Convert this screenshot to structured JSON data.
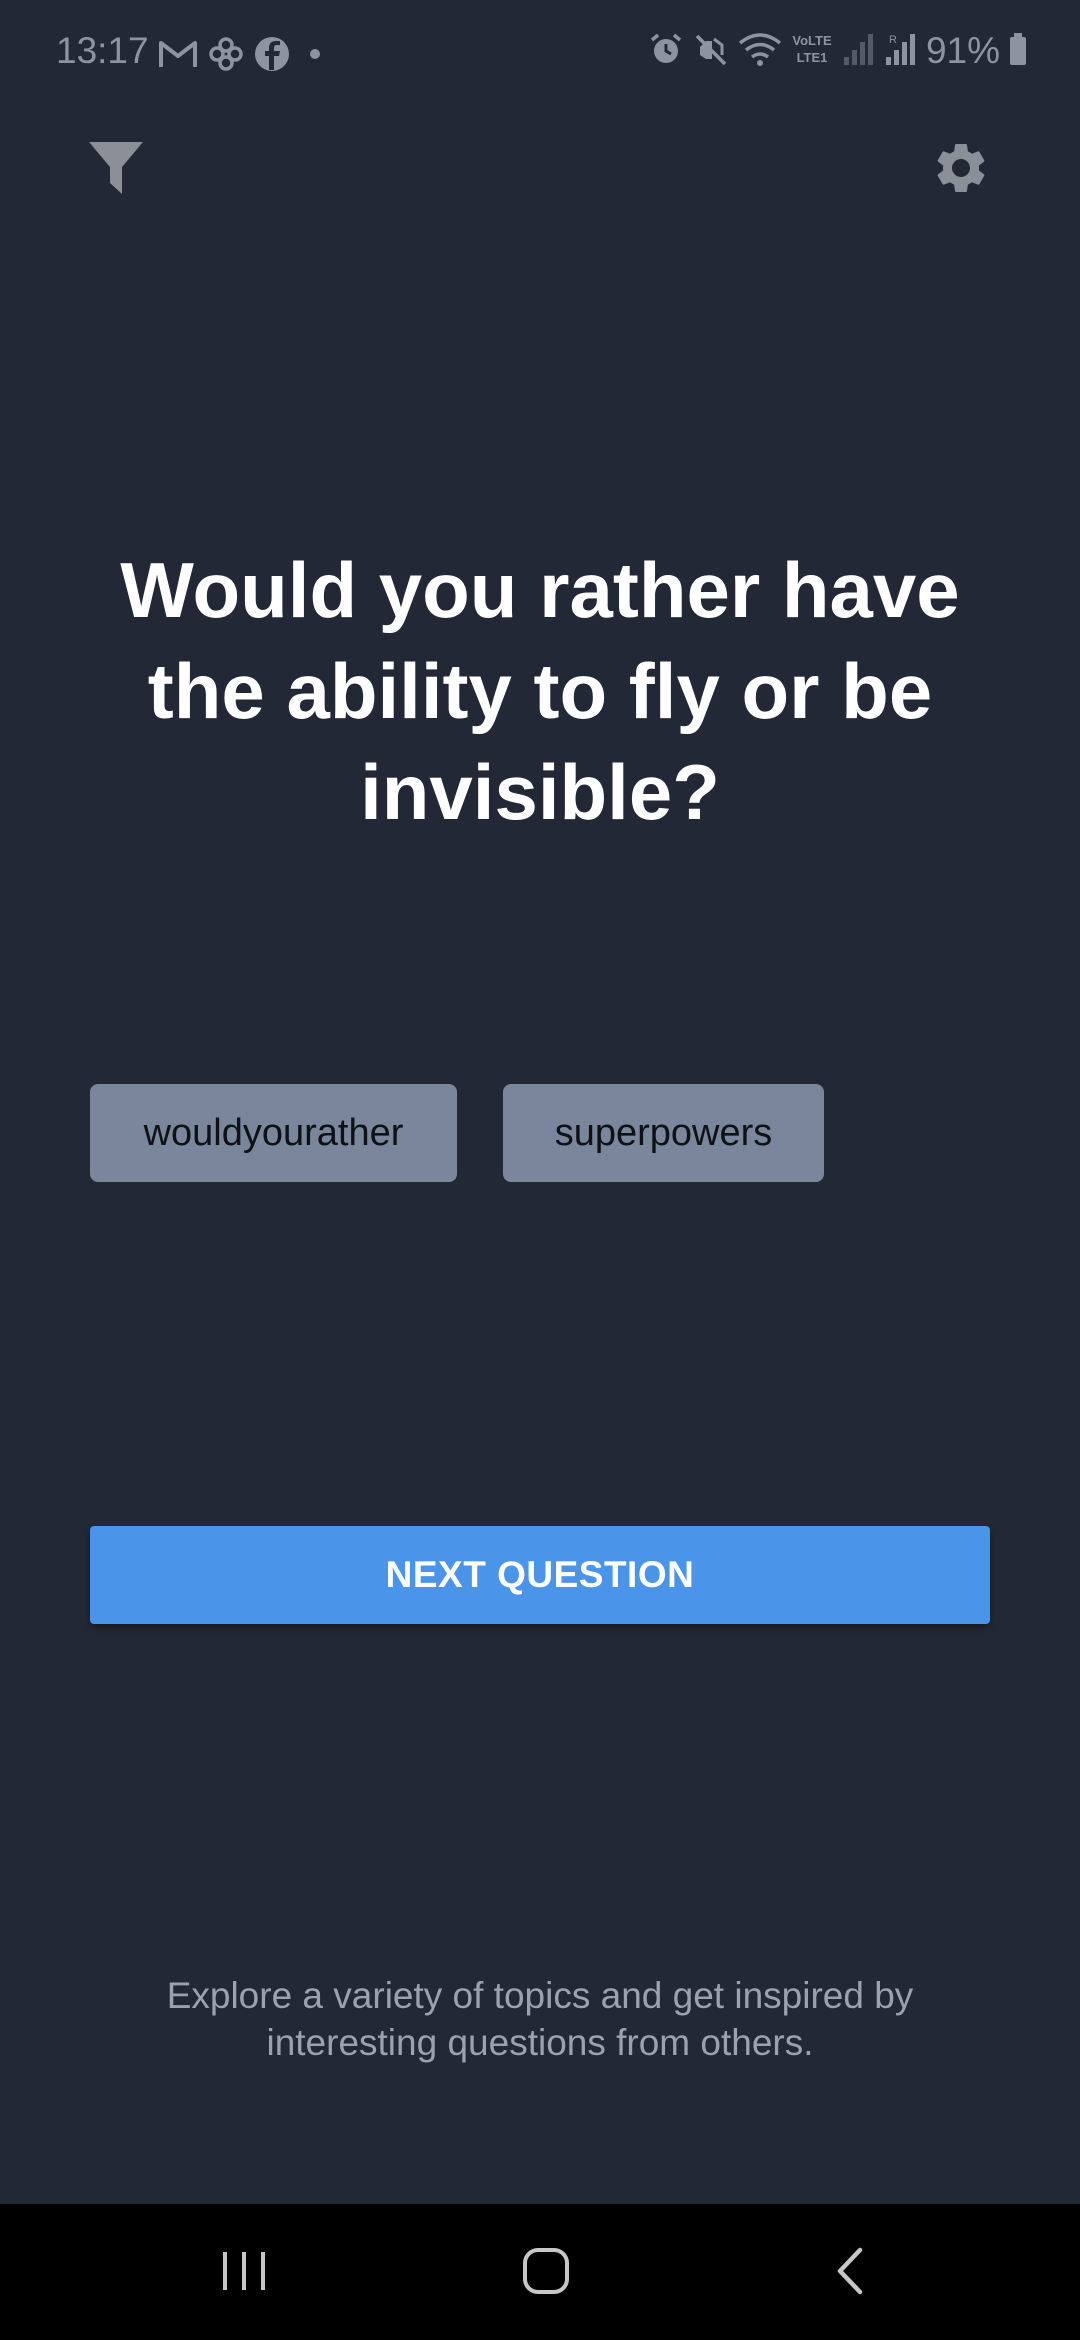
{
  "status_bar": {
    "time": "13:17",
    "battery": "91%",
    "left_icons": [
      "gmail-icon",
      "pinwheel-icon",
      "facebook-icon",
      "notification-dot-icon"
    ],
    "right_icons": [
      "alarm-icon",
      "mute-icon",
      "wifi-icon",
      "volte-icon",
      "signal-icon",
      "signal-roaming-icon",
      "battery-icon"
    ]
  },
  "toolbar": {
    "filter_icon": "filter-icon",
    "settings_icon": "gear-icon"
  },
  "question": {
    "text": "Would you rather have the ability to fly or be invisible?"
  },
  "tags": [
    {
      "label": "wouldyourather"
    },
    {
      "label": "superpowers"
    }
  ],
  "next_button": {
    "label": "NEXT QUESTION"
  },
  "footer": {
    "text": "Explore a variety of topics and get inspired by interesting questions from others."
  },
  "nav_bar": {
    "recents_icon": "recents-icon",
    "home_icon": "home-icon",
    "back_icon": "back-icon"
  },
  "colors": {
    "background": "#222835",
    "accent": "#4a94ea",
    "tag_background": "#79869c",
    "footer_text": "#9aa2ad",
    "icon_gray": "#8a8f98"
  }
}
